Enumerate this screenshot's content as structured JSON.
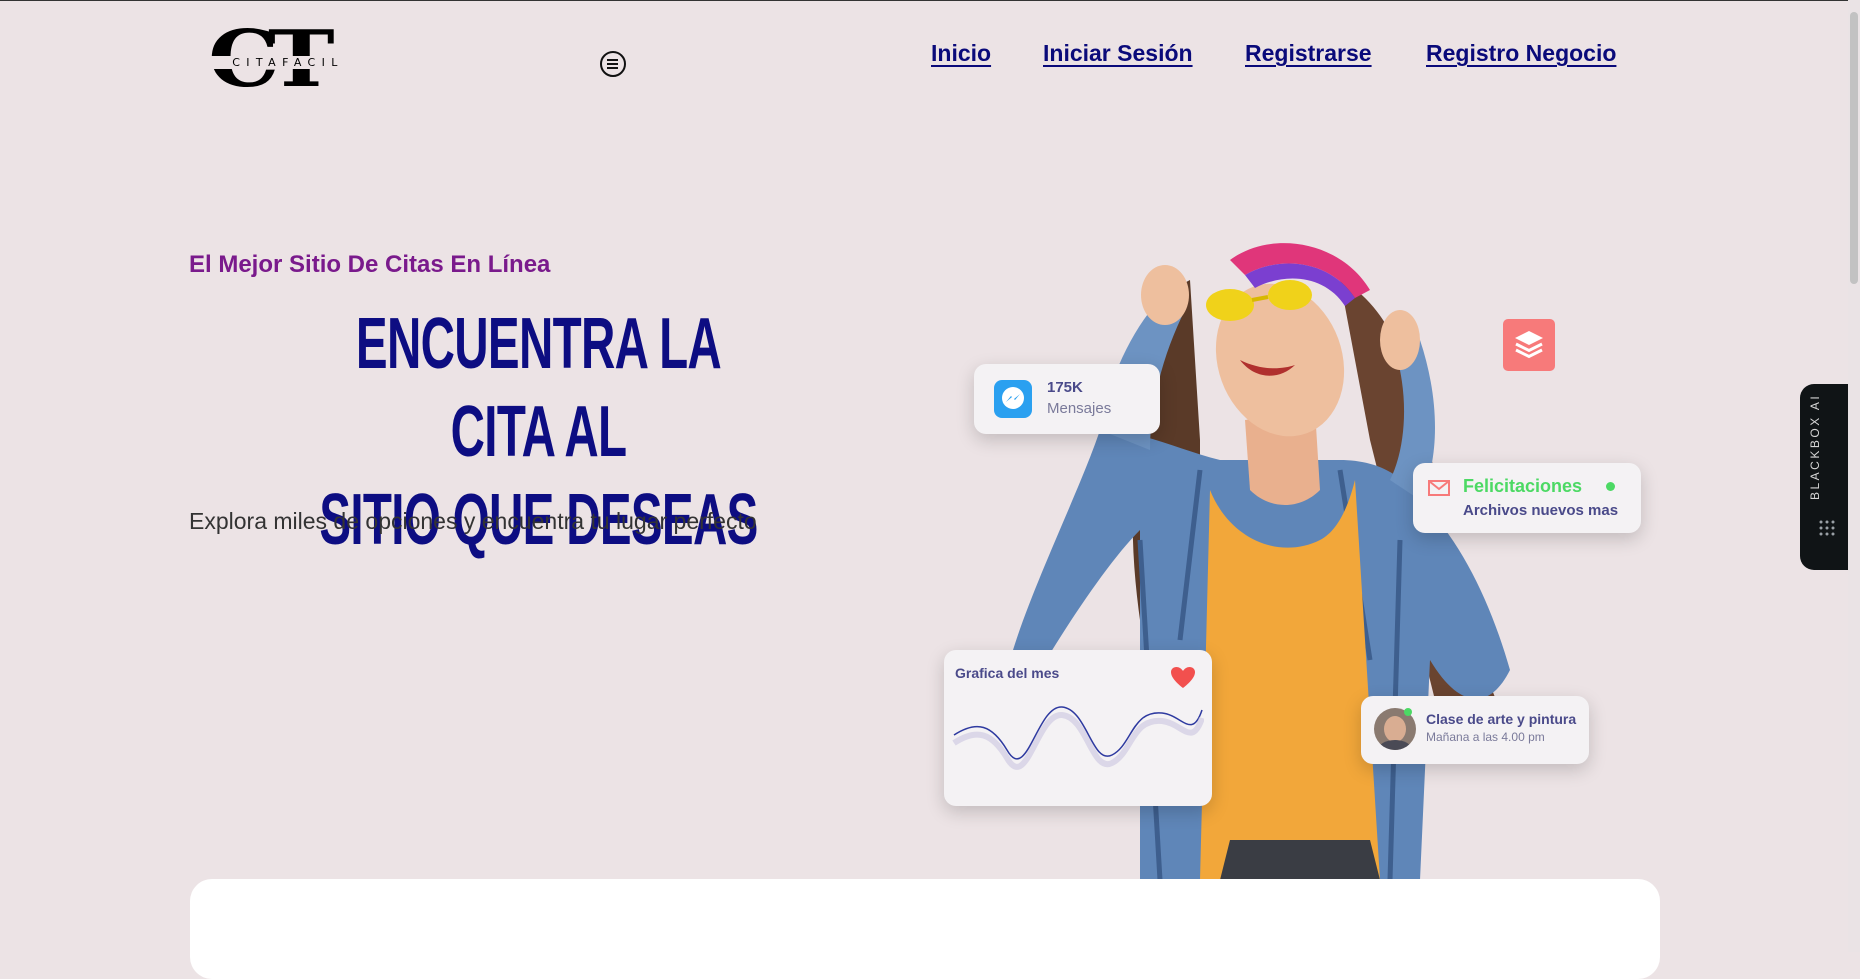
{
  "header": {
    "logo_letters": "CT",
    "logo_name": "CITAFACIL",
    "nav": [
      "Inicio",
      "Iniciar Sesión",
      "Registrarse",
      "Registro Negocio"
    ]
  },
  "hero": {
    "eyebrow": "El Mejor Sitio De Citas En Línea",
    "headline_line1": "ENCUENTRA LA CITA AL",
    "headline_line2": "SITIO QUE DESEAS",
    "subtext": "Explora miles de opciones y encuentra tu lugar perfecto"
  },
  "cards": {
    "messages": {
      "count": "175K",
      "label": "Mensajes"
    },
    "congrats": {
      "title": "Felicitaciones",
      "subtitle": "Archivos nuevos mas"
    },
    "chart": {
      "title": "Grafica del mes"
    },
    "event": {
      "title": "Clase de arte y pintura",
      "time": "Mañana a las 4.00 pm"
    }
  },
  "side_tab": {
    "label": "BLACKBOX AI"
  },
  "colors": {
    "background": "#ece3e5",
    "nav_link": "#0a0a7a",
    "headline": "#0d0d82",
    "eyebrow": "#7a1a8c",
    "accent_coral": "#f77a7a",
    "accent_green": "#4cd964",
    "messenger_blue": "#2aa0f0"
  },
  "icons": [
    "menu-circle-icon",
    "messenger-icon",
    "layers-icon",
    "mail-icon",
    "heart-icon",
    "avatar"
  ]
}
